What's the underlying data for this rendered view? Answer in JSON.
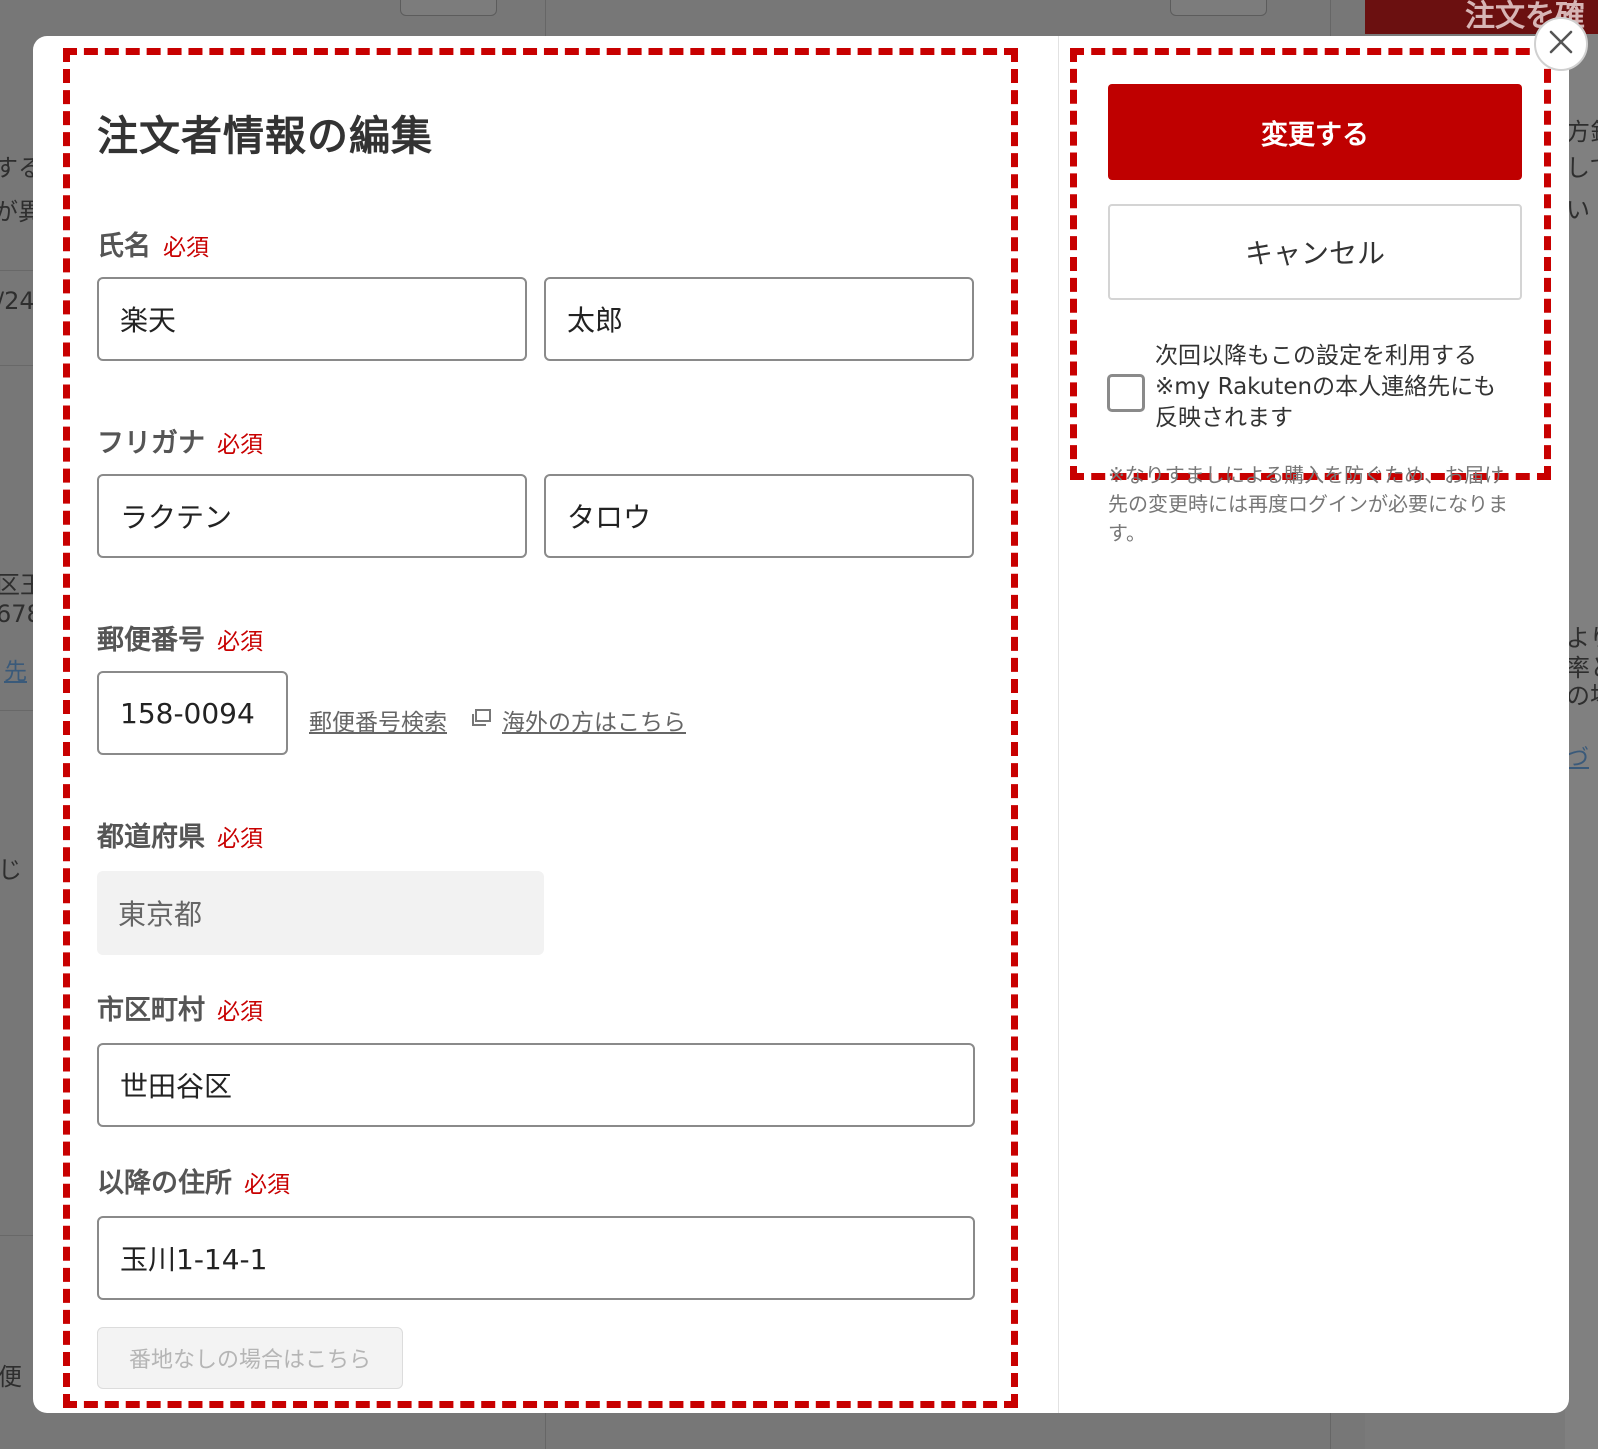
{
  "background": {
    "order_button_label": "注文を確",
    "fragments": [
      "する",
      "が異",
      "/24",
      "区王",
      "678",
      "先",
      "じ",
      "便",
      "方針",
      "して",
      "い",
      "より",
      "率と",
      "の場",
      "づ"
    ]
  },
  "modal": {
    "title": "注文者情報の編集",
    "required_tag": "必須",
    "name": {
      "label": "氏名",
      "last_name": "楽天",
      "first_name": "太郎"
    },
    "furigana": {
      "label": "フリガナ",
      "last_name": "ラクテン",
      "first_name": "タロウ"
    },
    "postal": {
      "label": "郵便番号",
      "value": "158-0094",
      "search_link": "郵便番号検索",
      "overseas_link": "海外の方はこちら"
    },
    "prefecture": {
      "label": "都道府県",
      "value": "東京都"
    },
    "city": {
      "label": "市区町村",
      "value": "世田谷区"
    },
    "address": {
      "label": "以降の住所",
      "value": "玉川1-14-1",
      "no_banchi_button": "番地なしの場合はこちら"
    },
    "actions": {
      "submit_label": "変更する",
      "cancel_label": "キャンセル"
    },
    "save_setting": {
      "line1": "次回以降もこの設定を利用する",
      "line2": "※my Rakutenの本人連絡先にも",
      "line3": "反映されます",
      "checked": false
    },
    "note": "※なりすましによる購入を防ぐため、お届け先の変更時には再度ログインが必要になります。"
  },
  "colors": {
    "accent": "#bf0000",
    "highlight_dash": "#c80000",
    "overlay": "#7a7a7a"
  }
}
